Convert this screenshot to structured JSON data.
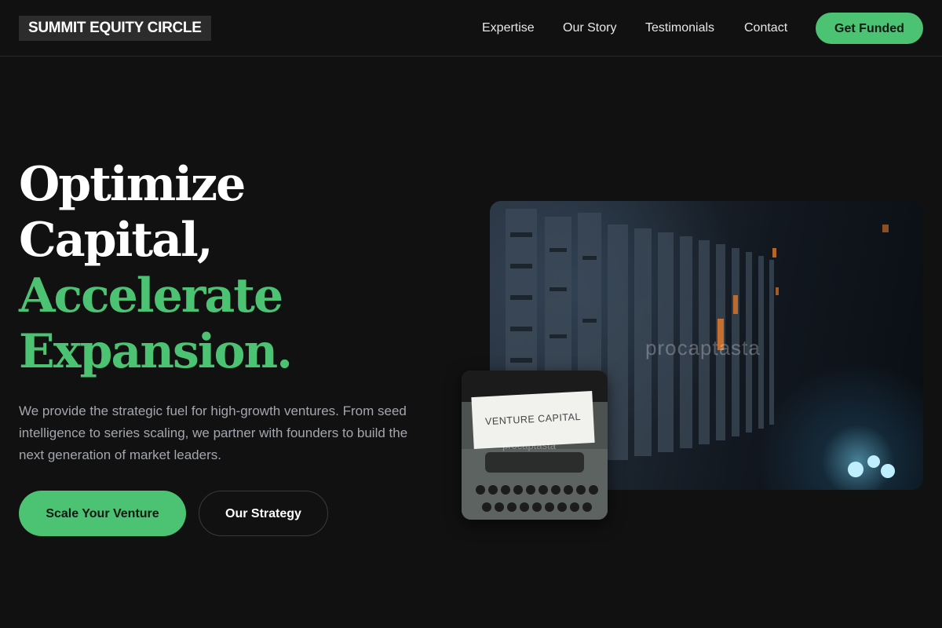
{
  "nav": {
    "logo": "SUMMIT EQUITY CIRCLE",
    "links": [
      "Expertise",
      "Our Story",
      "Testimonials",
      "Contact"
    ],
    "cta": "Get Funded"
  },
  "hero": {
    "headline_lines": [
      "Optimize",
      "Capital,"
    ],
    "headline_accent_lines": [
      "Accelerate",
      "Expansion."
    ],
    "subtitle": "We provide the strategic fuel for high-growth ventures. From seed intelligence to series scaling, we partner with founders to build the next generation of market leaders.",
    "primary_button": "Scale Your Venture",
    "secondary_button": "Our Strategy"
  },
  "images": {
    "main_watermark": "procaptasta",
    "secondary_paper_text": "VENTURE CAPITAL",
    "secondary_watermark": "procaptasta"
  },
  "colors": {
    "background": "#111111",
    "accent": "#4cc273",
    "muted_text": "#a3a7ad"
  }
}
